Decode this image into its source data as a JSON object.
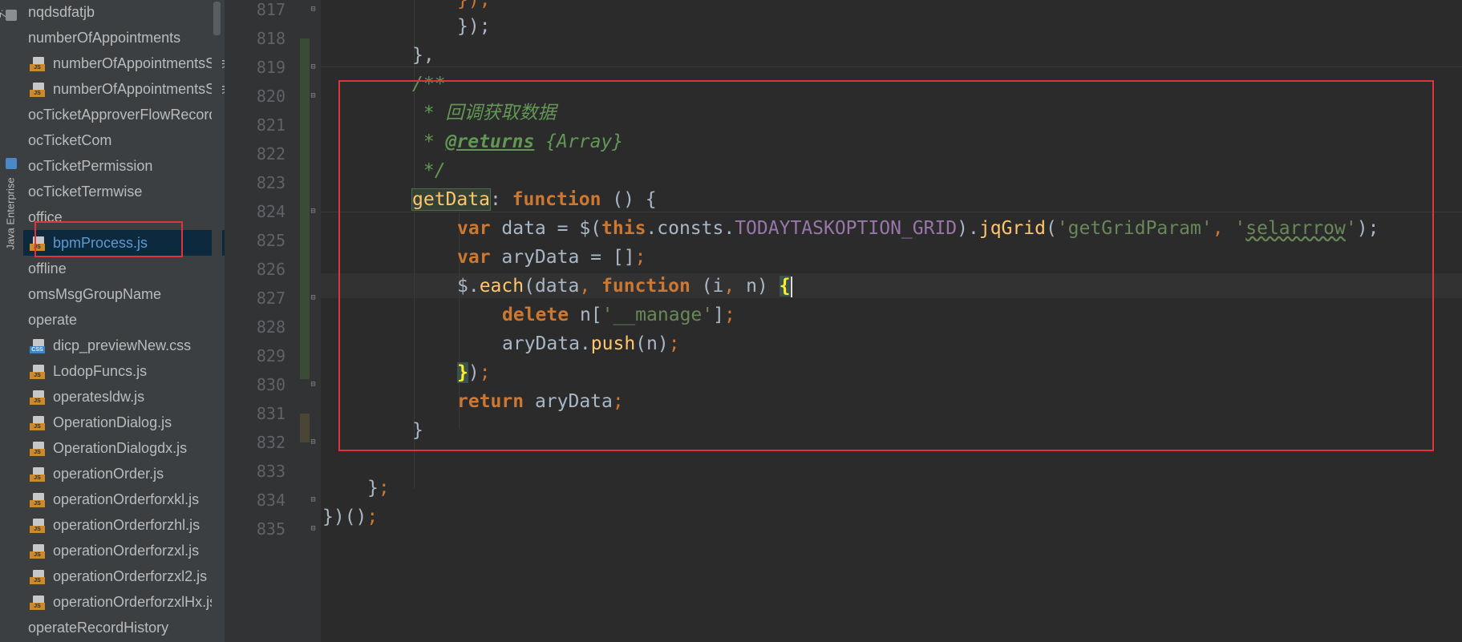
{
  "toolstrip": {
    "top_label": "Z:",
    "side_label": "Java Enterprise"
  },
  "tree": {
    "items": [
      {
        "label": "nqdsdfatjb",
        "icon": "none",
        "indent": 0
      },
      {
        "label": "numberOfAppointments",
        "icon": "none",
        "indent": 0
      },
      {
        "label": "numberOfAppointmentsStatistics.js",
        "icon": "js-file-icon",
        "indent": 1
      },
      {
        "label": "numberOfAppointmentsStatisticsNew.js",
        "icon": "js-file-icon",
        "indent": 1
      },
      {
        "label": "ocTicketApproverFlowRecord",
        "icon": "none",
        "indent": 0
      },
      {
        "label": "ocTicketCom",
        "icon": "none",
        "indent": 0
      },
      {
        "label": "ocTicketPermission",
        "icon": "none",
        "indent": 0
      },
      {
        "label": "ocTicketTermwise",
        "icon": "none",
        "indent": 0
      },
      {
        "label": "office",
        "icon": "none",
        "indent": 0
      },
      {
        "label": "bpmProcess.js",
        "icon": "js-file-icon",
        "indent": 1,
        "selected": true
      },
      {
        "label": "offline",
        "icon": "none",
        "indent": 0
      },
      {
        "label": "omsMsgGroupName",
        "icon": "none",
        "indent": 0
      },
      {
        "label": "operate",
        "icon": "none",
        "indent": 0
      },
      {
        "label": "dicp_previewNew.css",
        "icon": "css-file-icon",
        "indent": 1
      },
      {
        "label": "LodopFuncs.js",
        "icon": "js-file-icon",
        "indent": 1
      },
      {
        "label": "operatesldw.js",
        "icon": "js-file-icon",
        "indent": 1
      },
      {
        "label": "OperationDialog.js",
        "icon": "js-file-icon",
        "indent": 1
      },
      {
        "label": "OperationDialogdx.js",
        "icon": "js-file-icon",
        "indent": 1
      },
      {
        "label": "operationOrder.js",
        "icon": "js-file-icon",
        "indent": 1
      },
      {
        "label": "operationOrderforxkl.js",
        "icon": "js-file-icon",
        "indent": 1
      },
      {
        "label": "operationOrderforzhl.js",
        "icon": "js-file-icon",
        "indent": 1
      },
      {
        "label": "operationOrderforzxl.js",
        "icon": "js-file-icon",
        "indent": 1
      },
      {
        "label": "operationOrderforzxl2.js",
        "icon": "js-file-icon",
        "indent": 1
      },
      {
        "label": "operationOrderforzxlHx.js",
        "icon": "js-file-icon",
        "indent": 1
      },
      {
        "label": "operateRecordHistory",
        "icon": "none",
        "indent": 0
      }
    ],
    "icon_badge_js": "JS",
    "icon_badge_css": "CSS"
  },
  "gutter": {
    "line_numbers": [
      "817",
      "818",
      "819",
      "820",
      "821",
      "822",
      "823",
      "824",
      "825",
      "826",
      "827",
      "828",
      "829",
      "830",
      "831",
      "832",
      "833",
      "834",
      "835"
    ]
  },
  "code": {
    "l817": "});",
    "l818": "});",
    "l819": "},",
    "l820": "/**",
    "l821_star": " * ",
    "l821_text": "回调获取数据",
    "l822_star": " * ",
    "l822_tag": "@returns",
    "l822_type": " {Array}",
    "l823": " */",
    "l824_name": "getData",
    "l824_colon": ": ",
    "l824_kw": "function",
    "l824_rest": " () {",
    "l825_kw": "var",
    "l825_a": " data = $(",
    "l825_this": "this",
    "l825_b": ".consts.",
    "l825_const": "TODAYTASKOPTION_GRID",
    "l825_c": ").",
    "l825_fn": "jqGrid",
    "l825_d": "(",
    "l825_s1": "'getGridParam'",
    "l825_comma": ", ",
    "l825_q1": "'",
    "l825_s2": "selarrrow",
    "l825_q2": "'",
    "l825_e": ");",
    "l826_kw": "var",
    "l826_a": " aryData = []",
    "l826_semi": ";",
    "l827_a": "$.",
    "l827_fn": "each",
    "l827_b": "(data",
    "l827_comma": ", ",
    "l827_kw": "function",
    "l827_c": " (i",
    "l827_comma2": ", ",
    "l827_d": "n) ",
    "l827_brace": "{",
    "l828_kw": "delete",
    "l828_a": " n[",
    "l828_s": "'__manage'",
    "l828_b": "]",
    "l828_semi": ";",
    "l829_a": "aryData.",
    "l829_fn": "push",
    "l829_b": "(n)",
    "l829_semi": ";",
    "l830_brace": "}",
    "l830_a": ")",
    "l830_semi": ";",
    "l831_kw": "return",
    "l831_a": " aryData",
    "l831_semi": ";",
    "l832": "}",
    "l834_a": "}",
    "l834_semi": ";",
    "l835_a": "})()",
    "l835_semi": ";"
  },
  "colors": {
    "annotation": "#e0333b",
    "keyword": "#cc7832",
    "function_name": "#ffc66d",
    "string": "#6a8759",
    "doc_comment": "#629755",
    "constant": "#9876aa",
    "selection": "#0d293e"
  }
}
